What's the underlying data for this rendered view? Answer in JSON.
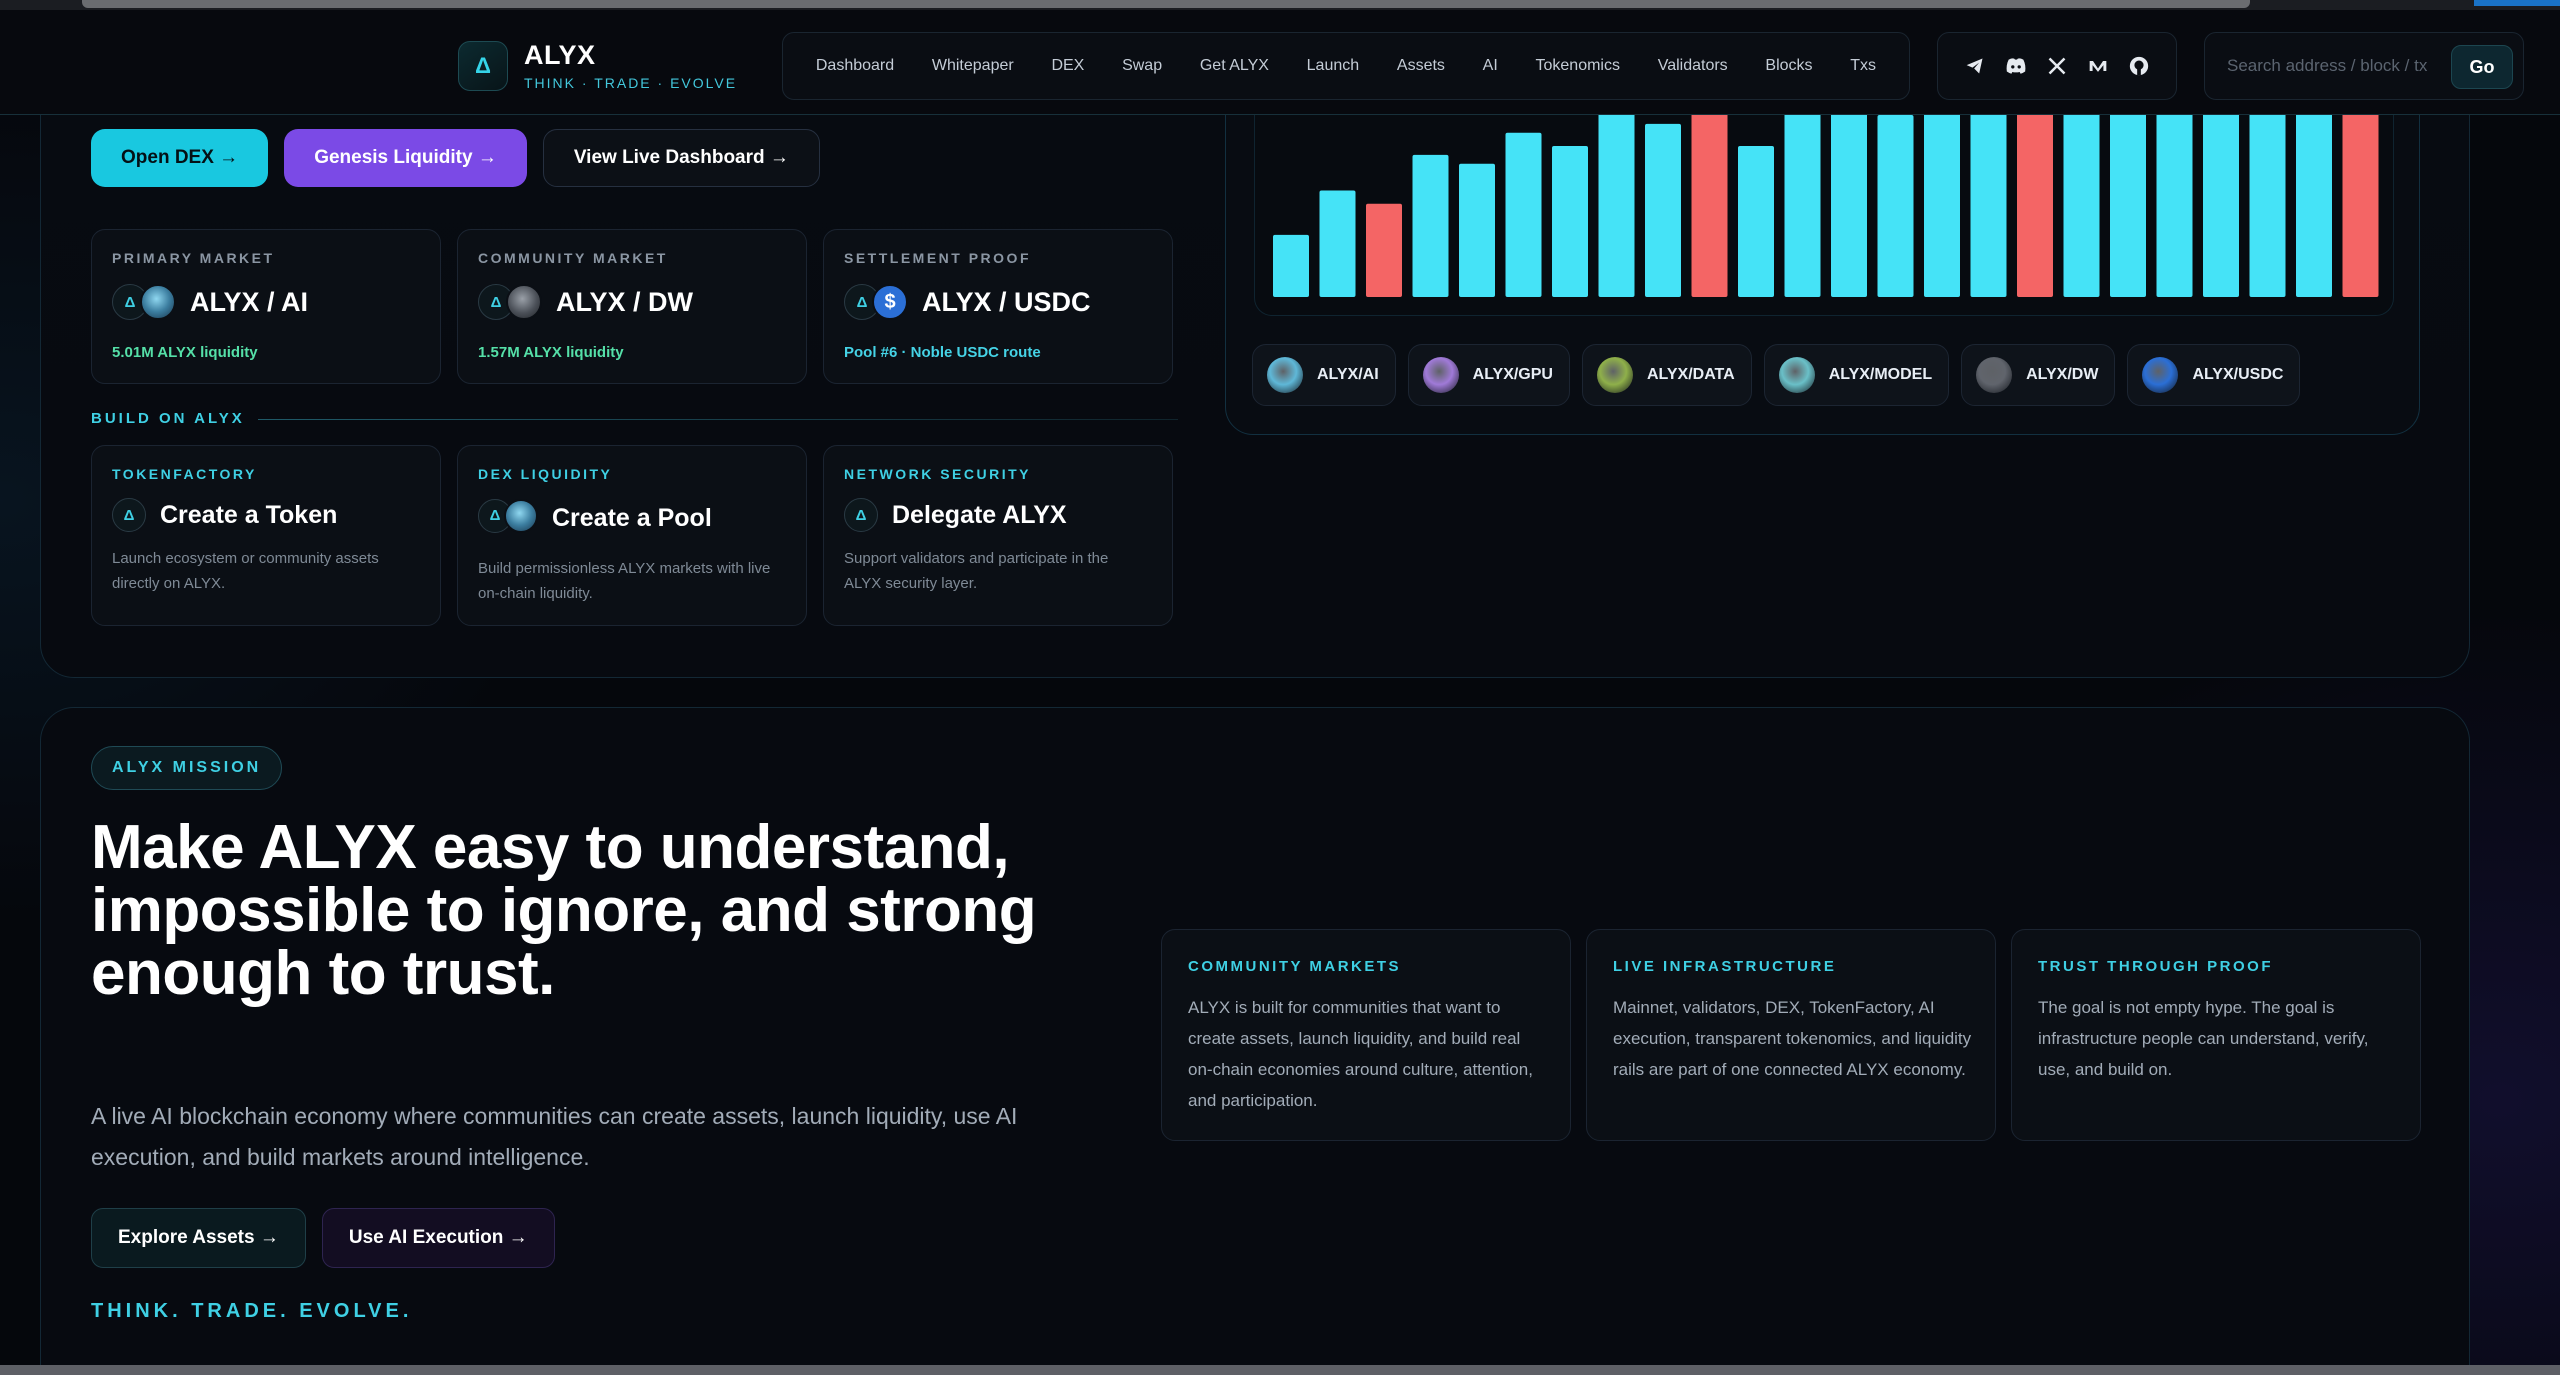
{
  "brand": {
    "name": "ALYX",
    "tagline": "THINK · TRADE · EVOLVE",
    "logo_glyph": "Δ"
  },
  "nav": {
    "links": [
      "Dashboard",
      "Whitepaper",
      "DEX",
      "Swap",
      "Get ALYX",
      "Launch",
      "Assets",
      "AI",
      "Tokenomics",
      "Validators",
      "Blocks",
      "Txs"
    ],
    "social_icons": [
      "telegram-icon",
      "discord-icon",
      "x-icon",
      "medium-icon",
      "github-icon"
    ],
    "search_placeholder": "Search address / block / tx",
    "go_label": "Go"
  },
  "hero": {
    "buttons": {
      "open_dex": "Open DEX →",
      "genesis": "Genesis Liquidity →",
      "dashboard": "View Live Dashboard →"
    },
    "markets": [
      {
        "label": "PRIMARY MARKET",
        "pair": "ALYX / AI",
        "sub": "5.01M ALYX liquidity"
      },
      {
        "label": "COMMUNITY MARKET",
        "pair": "ALYX / DW",
        "sub": "1.57M ALYX liquidity"
      },
      {
        "label": "SETTLEMENT PROOF",
        "pair": "ALYX / USDC",
        "sub": "Pool #6 · Noble USDC route"
      }
    ],
    "build_label": "BUILD ON ALYX",
    "build": [
      {
        "label": "TOKENFACTORY",
        "title": "Create a Token",
        "desc": "Launch ecosystem or community assets directly on ALYX."
      },
      {
        "label": "DEX LIQUIDITY",
        "title": "Create a Pool",
        "desc": "Build permissionless ALYX markets with live on-chain liquidity."
      },
      {
        "label": "NETWORK SECURITY",
        "title": "Delegate ALYX",
        "desc": "Support validators and participate in the ALYX security layer."
      }
    ]
  },
  "chart_data": {
    "type": "bar",
    "values": [
      28,
      48,
      42,
      64,
      60,
      74,
      68,
      84,
      78,
      92,
      68,
      84,
      87,
      82,
      96,
      90,
      98,
      97,
      99,
      98,
      99,
      98,
      99,
      97
    ],
    "down": [
      false,
      false,
      true,
      false,
      false,
      false,
      false,
      false,
      false,
      true,
      false,
      false,
      false,
      false,
      false,
      false,
      true,
      false,
      false,
      false,
      false,
      false,
      false,
      true
    ],
    "ylim": [
      0,
      100
    ],
    "colors": {
      "up": "#45e3f7",
      "down": "#f46565"
    },
    "grid": false
  },
  "pair_chips": [
    {
      "label": "ALYX/AI",
      "color": "#5fb8d8"
    },
    {
      "label": "ALYX/GPU",
      "color": "#a07ad8"
    },
    {
      "label": "ALYX/DATA",
      "color": "#8fb04a"
    },
    {
      "label": "ALYX/MODEL",
      "color": "#6ac0c8"
    },
    {
      "label": "ALYX/DW",
      "color": "#60646c"
    },
    {
      "label": "ALYX/USDC",
      "color": "#2b6fd6"
    }
  ],
  "mission": {
    "badge": "ALYX MISSION",
    "headline": "Make ALYX easy to understand, impossible to ignore, and strong enough to trust.",
    "lede": "A live AI blockchain economy where communities can create assets, launch liquidity, use AI execution, and build markets around intelligence.",
    "buttons": {
      "explore": "Explore Assets →",
      "ai": "Use AI Execution →"
    },
    "tagline": "THINK. TRADE. EVOLVE.",
    "cards": [
      {
        "title": "COMMUNITY MARKETS",
        "body": "ALYX is built for communities that want to create assets, launch liquidity, and build real on-chain economies around culture, attention, and participation."
      },
      {
        "title": "LIVE INFRASTRUCTURE",
        "body": "Mainnet, validators, DEX, TokenFactory, AI execution, transparent tokenomics, and liquidity rails are part of one connected ALYX economy."
      },
      {
        "title": "TRUST THROUGH PROOF",
        "body": "The goal is not empty hype. The goal is infrastructure people can understand, verify, use, and build on."
      }
    ]
  }
}
